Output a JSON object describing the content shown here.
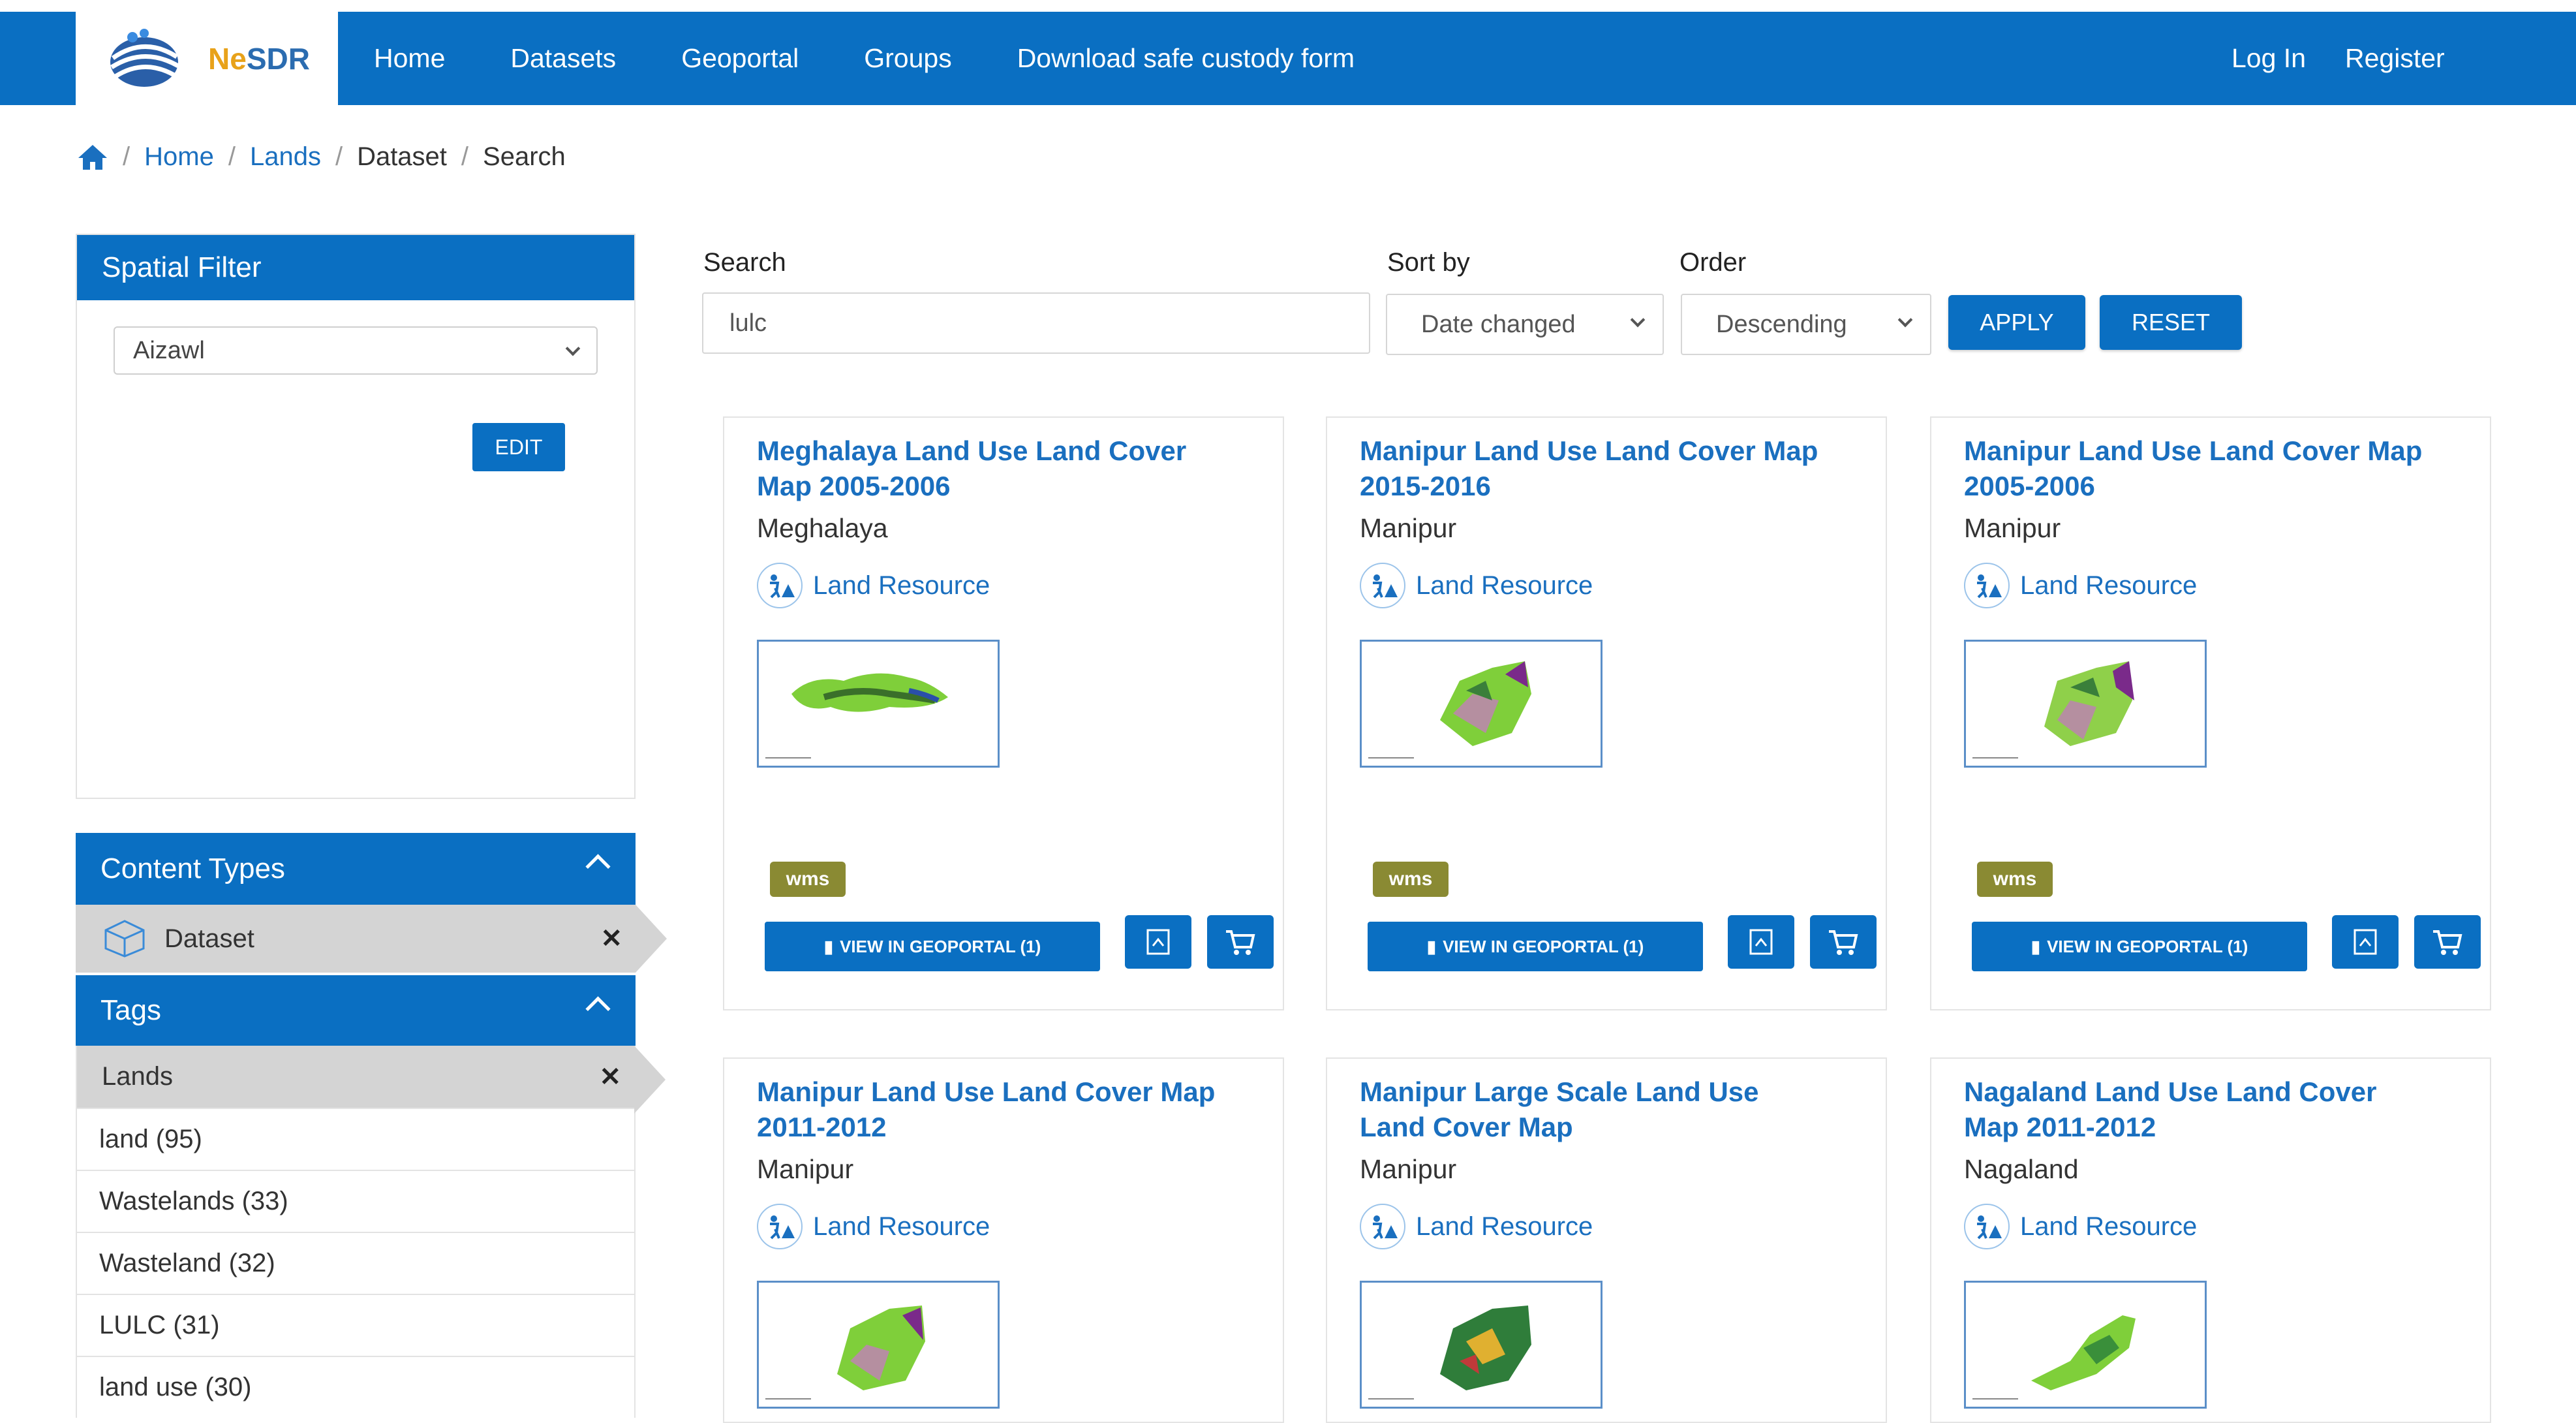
{
  "header": {
    "logo_text_part1": "Ne",
    "logo_text_part2": "SDR",
    "nav": [
      "Home",
      "Datasets",
      "Geoportal",
      "Groups",
      "Download safe custody form"
    ],
    "login": "Log In",
    "register": "Register"
  },
  "breadcrumb": [
    "Home",
    "Lands",
    "Dataset",
    "Search"
  ],
  "sidebar": {
    "spatial_filter": {
      "title": "Spatial Filter",
      "selected": "Aizawl",
      "edit_label": "EDIT"
    },
    "content_types": {
      "title": "Content Types",
      "active": "Dataset"
    },
    "tags": {
      "title": "Tags",
      "active": "Lands",
      "items": [
        "land (95)",
        "Wastelands (33)",
        "Wasteland (32)",
        "LULC (31)",
        "land use (30)"
      ]
    }
  },
  "search": {
    "label": "Search",
    "value": "lulc",
    "sort_label": "Sort by",
    "sort_value": "Date changed",
    "order_label": "Order",
    "order_value": "Descending",
    "apply": "APPLY",
    "reset": "RESET"
  },
  "cards": [
    {
      "title": "Meghalaya Land Use Land Cover Map 2005-2006",
      "region": "Meghalaya",
      "category": "Land Resource",
      "badge": "wms",
      "view_label": "VIEW IN GEOPORTAL (1)"
    },
    {
      "title": "Manipur Land Use Land Cover Map 2015-2016",
      "region": "Manipur",
      "category": "Land Resource",
      "badge": "wms",
      "view_label": "VIEW IN GEOPORTAL (1)"
    },
    {
      "title": "Manipur Land Use Land Cover Map 2005-2006",
      "region": "Manipur",
      "category": "Land Resource",
      "badge": "wms",
      "view_label": "VIEW IN GEOPORTAL (1)"
    },
    {
      "title": "Manipur Land Use Land Cover Map 2011-2012",
      "region": "Manipur",
      "category": "Land Resource"
    },
    {
      "title": "Manipur Large Scale Land Use Land Cover Map",
      "region": "Manipur",
      "category": "Land Resource"
    },
    {
      "title": "Nagaland Land Use Land Cover Map 2011-2012",
      "region": "Nagaland",
      "category": "Land Resource"
    }
  ],
  "colors": {
    "primary": "#0a6fc2",
    "badge": "#8a8a33",
    "link": "#1a6fbf"
  }
}
